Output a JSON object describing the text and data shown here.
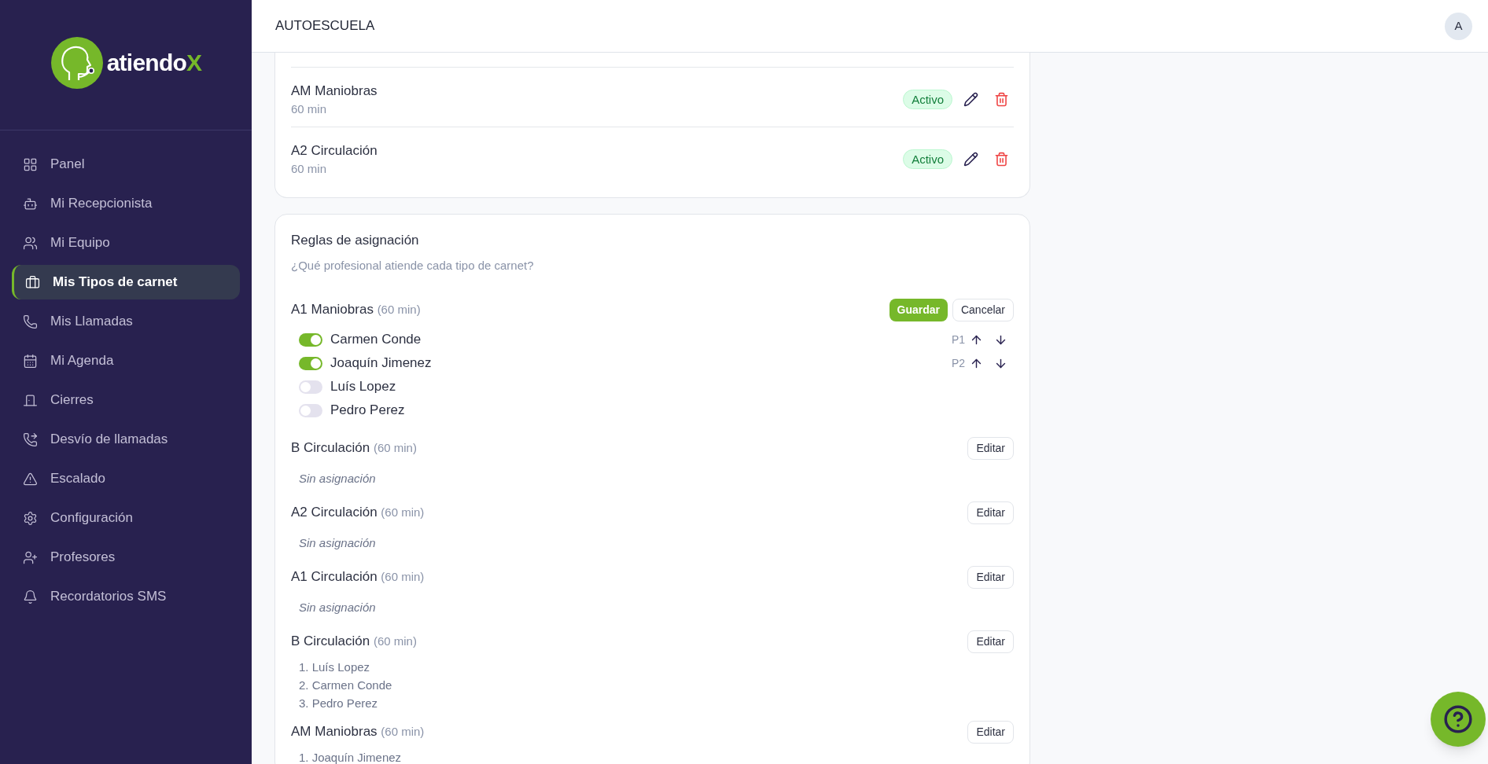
{
  "header": {
    "title": "AUTOESCUELA",
    "avatar": "A"
  },
  "sidebar": {
    "logo": {
      "text": "atiendo",
      "accent": "X"
    },
    "items": [
      {
        "label": "Panel",
        "selected": false
      },
      {
        "label": "Mi Recepcionista",
        "selected": false
      },
      {
        "label": "Mi Equipo",
        "selected": false
      },
      {
        "label": "Mis Tipos de carnet",
        "selected": true
      },
      {
        "label": "Mis Llamadas",
        "selected": false
      },
      {
        "label": "Mi Agenda",
        "selected": false
      },
      {
        "label": "Cierres",
        "selected": false
      },
      {
        "label": "Desvío de llamadas",
        "selected": false
      },
      {
        "label": "Escalado",
        "selected": false
      },
      {
        "label": "Configuración",
        "selected": false
      },
      {
        "label": "Profesores",
        "selected": false
      },
      {
        "label": "Recordatorios SMS",
        "selected": false
      }
    ]
  },
  "carnet_types": [
    {
      "name": "AM Maniobras",
      "duration": "60 min",
      "status": "Activo"
    },
    {
      "name": "A2 Circulación",
      "duration": "60 min",
      "status": "Activo"
    }
  ],
  "rules": {
    "title": "Reglas de asignación",
    "subtitle": "¿Qué profesional atiende cada tipo de carnet?",
    "items": [
      {
        "kind": "editing",
        "name": "A1 Maniobras",
        "duration": "(60 min)",
        "save": "Guardar",
        "cancel": "Cancelar",
        "professionals": [
          {
            "name": "Carmen Conde",
            "on": true,
            "priority": "P1"
          },
          {
            "name": "Joaquín Jimenez",
            "on": true,
            "priority": "P2"
          },
          {
            "name": "Luís Lopez",
            "on": false
          },
          {
            "name": "Pedro Perez",
            "on": false
          }
        ]
      },
      {
        "kind": "view",
        "name": "B Circulación",
        "duration": "(60 min)",
        "edit": "Editar",
        "empty": "Sin asignación"
      },
      {
        "kind": "view",
        "name": "A2 Circulación",
        "duration": "(60 min)",
        "edit": "Editar",
        "empty": "Sin asignación"
      },
      {
        "kind": "view",
        "name": "A1 Circulación",
        "duration": "(60 min)",
        "edit": "Editar",
        "empty": "Sin asignación"
      },
      {
        "kind": "view",
        "name": "B Circulación",
        "duration": "(60 min)",
        "edit": "Editar",
        "assigned": [
          "1. Luís Lopez",
          "2. Carmen Conde",
          "3. Pedro Perez"
        ]
      },
      {
        "kind": "view",
        "name": "AM Maniobras",
        "duration": "(60 min)",
        "edit": "Editar",
        "assigned": [
          "1. Joaquín Jimenez"
        ]
      }
    ]
  }
}
